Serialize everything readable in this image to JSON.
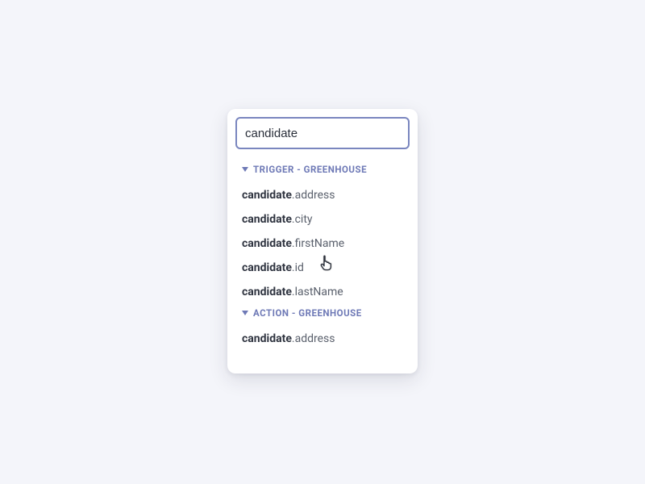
{
  "search": {
    "value": "candidate",
    "icon": "search-icon"
  },
  "sections": [
    {
      "label": "Trigger - Greenhouse",
      "items": [
        {
          "match": "candidate",
          "rest": ".address"
        },
        {
          "match": "candidate",
          "rest": ".city"
        },
        {
          "match": "candidate",
          "rest": ".firstName"
        },
        {
          "match": "candidate",
          "rest": ".id"
        },
        {
          "match": "candidate",
          "rest": ".lastName"
        }
      ]
    },
    {
      "label": "Action - Greenhouse",
      "items": [
        {
          "match": "candidate",
          "rest": ".address"
        }
      ]
    }
  ]
}
